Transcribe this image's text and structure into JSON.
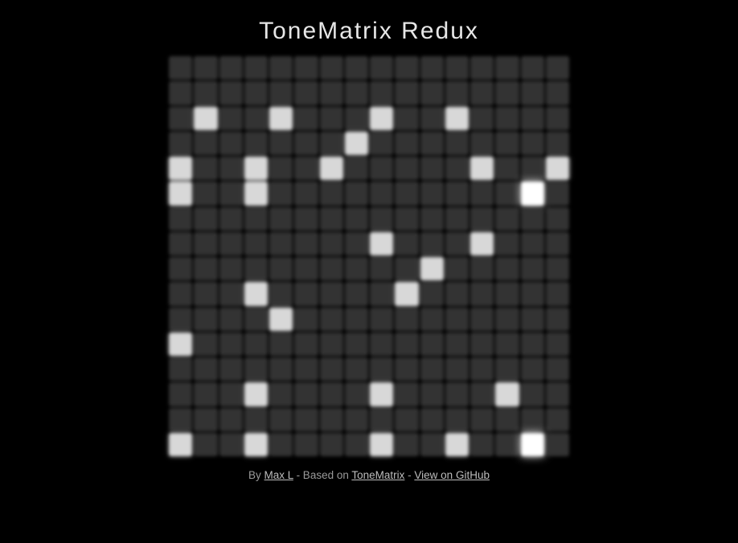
{
  "title": "ToneMatrix Redux",
  "footer": {
    "by_prefix": "By ",
    "author": "Max L",
    "sep1": " - Based on ",
    "based_on": "ToneMatrix",
    "sep2": " - ",
    "github": "View on GitHub"
  },
  "grid": {
    "rows": 16,
    "cols": 16,
    "bright_col": 14,
    "cells": [
      [
        0,
        0,
        0,
        0,
        0,
        0,
        0,
        0,
        0,
        0,
        0,
        0,
        0,
        0,
        0,
        0
      ],
      [
        0,
        0,
        0,
        0,
        0,
        0,
        0,
        0,
        0,
        0,
        0,
        0,
        0,
        0,
        0,
        0
      ],
      [
        0,
        1,
        0,
        0,
        1,
        0,
        0,
        0,
        1,
        0,
        0,
        1,
        0,
        0,
        0,
        0
      ],
      [
        0,
        0,
        0,
        0,
        0,
        0,
        0,
        1,
        0,
        0,
        0,
        0,
        0,
        0,
        0,
        0
      ],
      [
        1,
        0,
        0,
        1,
        0,
        0,
        1,
        0,
        0,
        0,
        0,
        0,
        1,
        0,
        0,
        1
      ],
      [
        1,
        0,
        0,
        1,
        0,
        0,
        0,
        0,
        0,
        0,
        0,
        0,
        0,
        0,
        1,
        0
      ],
      [
        0,
        0,
        0,
        0,
        0,
        0,
        0,
        0,
        0,
        0,
        0,
        0,
        0,
        0,
        0,
        0
      ],
      [
        0,
        0,
        0,
        0,
        0,
        0,
        0,
        0,
        1,
        0,
        0,
        0,
        1,
        0,
        0,
        0
      ],
      [
        0,
        0,
        0,
        0,
        0,
        0,
        0,
        0,
        0,
        0,
        1,
        0,
        0,
        0,
        0,
        0
      ],
      [
        0,
        0,
        0,
        1,
        0,
        0,
        0,
        0,
        0,
        1,
        0,
        0,
        0,
        0,
        0,
        0
      ],
      [
        0,
        0,
        0,
        0,
        1,
        0,
        0,
        0,
        0,
        0,
        0,
        0,
        0,
        0,
        0,
        0
      ],
      [
        1,
        0,
        0,
        0,
        0,
        0,
        0,
        0,
        0,
        0,
        0,
        0,
        0,
        0,
        0,
        0
      ],
      [
        0,
        0,
        0,
        0,
        0,
        0,
        0,
        0,
        0,
        0,
        0,
        0,
        0,
        0,
        0,
        0
      ],
      [
        0,
        0,
        0,
        1,
        0,
        0,
        0,
        0,
        1,
        0,
        0,
        0,
        0,
        1,
        0,
        0
      ],
      [
        0,
        0,
        0,
        0,
        0,
        0,
        0,
        0,
        0,
        0,
        0,
        0,
        0,
        0,
        0,
        0
      ],
      [
        1,
        0,
        0,
        1,
        0,
        0,
        0,
        0,
        1,
        0,
        0,
        1,
        0,
        0,
        1,
        0
      ]
    ]
  }
}
